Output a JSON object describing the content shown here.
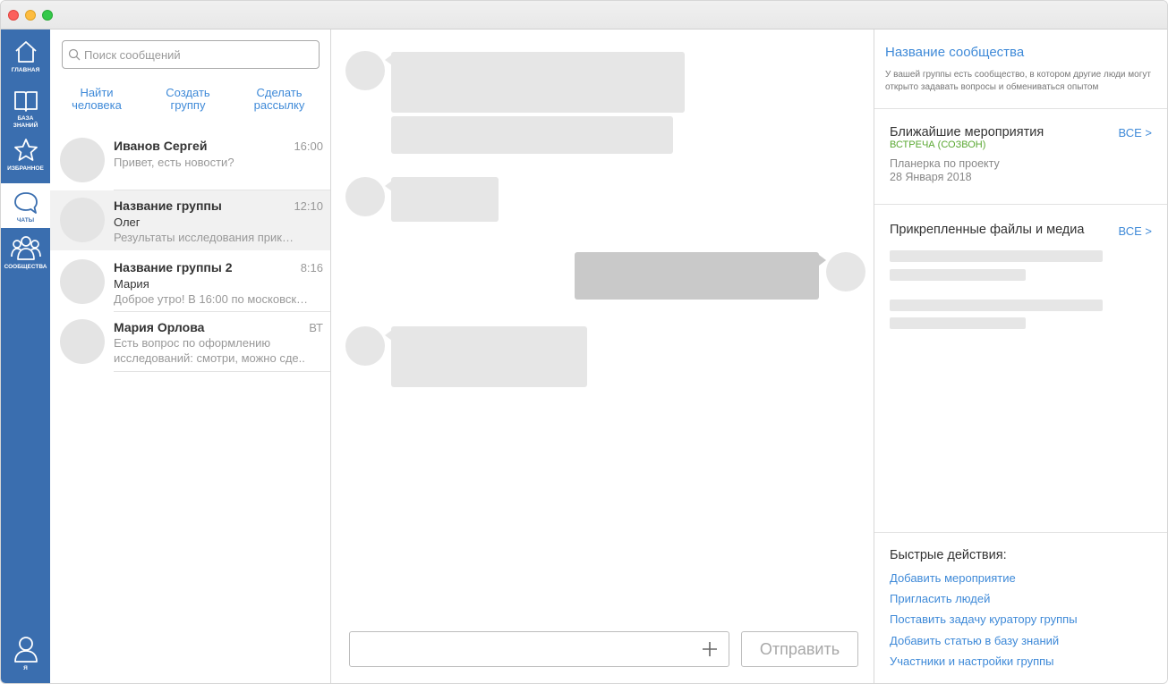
{
  "nav": {
    "items": [
      {
        "label": "ГЛАВНАЯ",
        "icon": "home-icon"
      },
      {
        "label": "БАЗА ЗНАНИЙ",
        "icon": "book-icon"
      },
      {
        "label": "ИЗБРАННОЕ",
        "icon": "star-icon"
      },
      {
        "label": "ЧАТЫ",
        "icon": "chat-icon"
      },
      {
        "label": "СООБЩЕСТВА",
        "icon": "people-icon"
      }
    ],
    "profile_label": "Я",
    "active": "ЧАТЫ",
    "accent_color": "#3a6eaf"
  },
  "chat_list": {
    "search_placeholder": "Поиск сообщений",
    "actions": [
      {
        "line1": "Найти",
        "line2": "человека"
      },
      {
        "line1": "Создать",
        "line2": "группу"
      },
      {
        "line1": "Сделать",
        "line2": "рассылку"
      }
    ],
    "chats": [
      {
        "name": "Иванов Сергей",
        "time": "16:00",
        "preview": "Привет, есть новости?"
      },
      {
        "name": "Название группы",
        "time": "12:10",
        "sender": "Олег",
        "preview": "Результаты исследования прик…"
      },
      {
        "name": "Название группы 2",
        "time": "8:16",
        "sender": "Мария",
        "preview": "Доброе утро! В 16:00 по московск…"
      },
      {
        "name": "Мария Орлова",
        "time": "ВТ",
        "preview": "Есть вопрос по оформлению исследований: смотри, можно сде.."
      }
    ]
  },
  "conversation": {
    "composer_value": "",
    "send_label": "Отправить"
  },
  "info": {
    "community_title": "Название сообщества",
    "community_desc": "У вашей группы есть сообщество, в котором другие люди могут открыто задавать вопросы и обмениваться опытом",
    "events_title": "Ближайшие мероприятия",
    "events_all": "ВСЕ >",
    "event_type": "ВСТРЕЧА (СОЗВОН)",
    "event_name": "Планерка по проекту",
    "event_date": "28 Января 2018",
    "files_title": "Прикрепленные файлы и медиа",
    "files_all": "ВСЕ >",
    "quick_title": "Быстрые действия:",
    "quick_actions": [
      "Добавить мероприятие",
      "Пригласить людей",
      "Поставить задачу куратору группы",
      "Добавить статью в базу знаний",
      "Участники и настройки группы"
    ]
  }
}
